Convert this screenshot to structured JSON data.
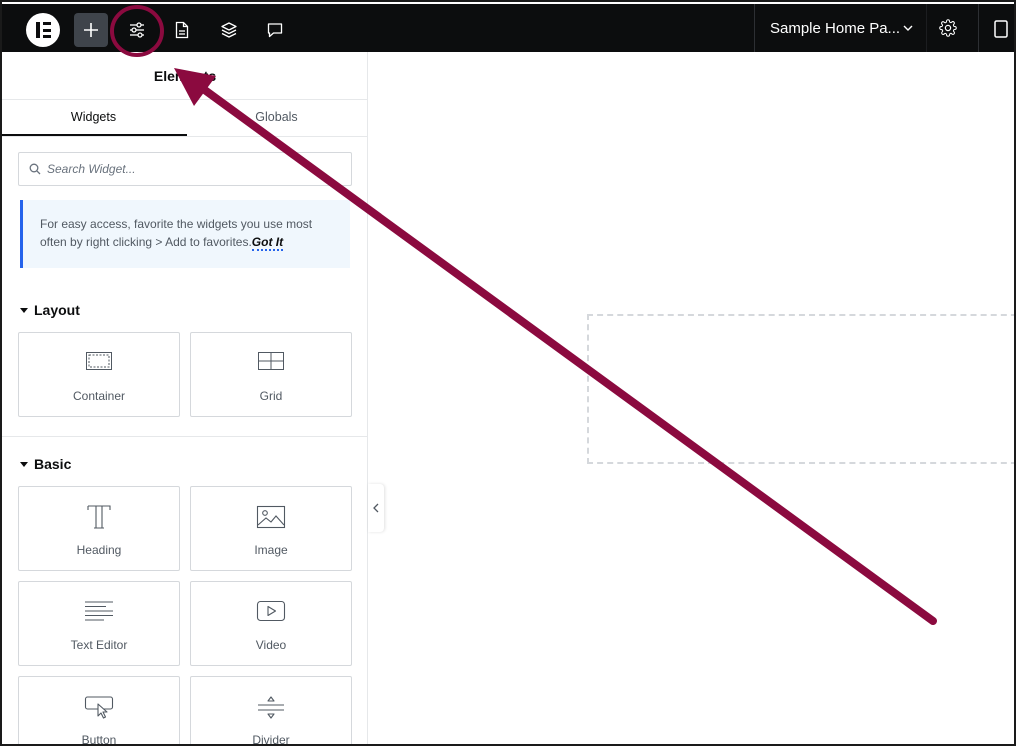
{
  "topbar": {
    "page_name": "Sample Home Pa...",
    "buttons": [
      "add-element",
      "site-settings",
      "page-settings",
      "structure",
      "notes"
    ]
  },
  "panel": {
    "title": "Elements",
    "tabs": [
      {
        "label": "Widgets",
        "active": true
      },
      {
        "label": "Globals",
        "active": false
      }
    ],
    "search_placeholder": "Search Widget...",
    "notice": {
      "text": "For easy access, favorite the widgets you use most often by right clicking > Add to favorites.",
      "link": "Got It"
    },
    "sections": [
      {
        "title": "Layout",
        "widgets": [
          {
            "label": "Container",
            "icon": "container-icon"
          },
          {
            "label": "Grid",
            "icon": "grid-icon"
          }
        ]
      },
      {
        "title": "Basic",
        "widgets": [
          {
            "label": "Heading",
            "icon": "heading-icon"
          },
          {
            "label": "Image",
            "icon": "image-icon"
          },
          {
            "label": "Text Editor",
            "icon": "text-editor-icon"
          },
          {
            "label": "Video",
            "icon": "video-icon"
          },
          {
            "label": "Button",
            "icon": "button-icon"
          },
          {
            "label": "Divider",
            "icon": "divider-icon"
          }
        ]
      }
    ]
  },
  "colors": {
    "topbar_bg": "#0c0d0e",
    "annotation": "#8b0a3f",
    "notice_accent": "#2563eb"
  }
}
